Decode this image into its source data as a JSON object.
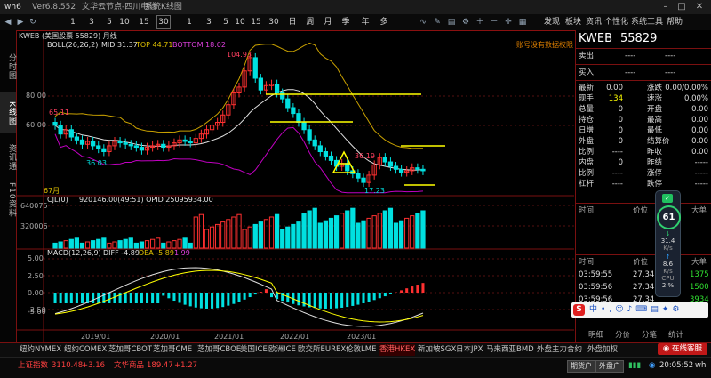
{
  "window": {
    "title": "wh6",
    "version": "Ver6.8.552",
    "node": "文华云节点-四川电信",
    "system": "系统K线图"
  },
  "toolbar": {
    "periods": [
      "1",
      "3",
      "5",
      "10",
      "15",
      "30",
      "1",
      "3",
      "5",
      "10",
      "15",
      "30",
      "日",
      "周",
      "月",
      "季",
      "年",
      "多"
    ],
    "menus": [
      "发现",
      "板块",
      "资讯",
      "个性化",
      "系统工具",
      "帮助"
    ]
  },
  "left_tabs": [
    "分时图",
    "K线图",
    "资讯通",
    "F10资料"
  ],
  "chart": {
    "symbol_header": "KWEB (美国股票 55829)  月线",
    "boll_label": "BOLL(26,26,2)",
    "mid_label": "MID 31.37",
    "top_label": "TOP 44.71",
    "bottom_label": "BOTTOM 18.02",
    "notice": "账号没有数据权限",
    "max_price": "104.93",
    "price_6511": "65.11",
    "price_3603": "36.03",
    "price_3619": "36.19",
    "price_1723": "17.23",
    "bar_count": "67月",
    "price_ticks": [
      "80.00",
      "60.00"
    ],
    "volume_label": "CJL(0)",
    "volume_values": "920146.00(49:51)  OPID 25095934.00",
    "volume_ticks": [
      "640075",
      "320006"
    ],
    "macd_label": "MACD(12,26,9)",
    "diff_label": "DIFF -4.89",
    "dea_label": "DEA -5.89",
    "macd_val": "1.99",
    "macd_ticks": [
      "5.00",
      "2.50",
      "0.00",
      "-2.50",
      "-5.00"
    ],
    "x_ticks": [
      "2019/01",
      "2020/01",
      "2021/01",
      "2022/01",
      "2023/01"
    ]
  },
  "right_panel": {
    "symbol": "KWEB",
    "code": "55829",
    "sell_label": "卖出",
    "buy_label": "买入",
    "dash": "----",
    "rows": [
      {
        "l1": "最新",
        "v1": "0.00",
        "l2": "涨跌",
        "v2": "0.00/0.00%"
      },
      {
        "l1": "现手",
        "v1": "134",
        "l2": "速涨",
        "v2": "0.00%"
      },
      {
        "l1": "总量",
        "v1": "0",
        "l2": "开盘",
        "v2": "0.00"
      },
      {
        "l1": "持仓",
        "v1": "0",
        "l2": "最高",
        "v2": "0.00"
      },
      {
        "l1": "日增",
        "v1": "0",
        "l2": "最低",
        "v2": "0.00"
      },
      {
        "l1": "外盘",
        "v1": "0",
        "l2": "结算价",
        "v2": "0.00"
      },
      {
        "l1": "比例",
        "v1": "----",
        "l2": "昨收",
        "v2": "0.00"
      },
      {
        "l1": "内盘",
        "v1": "0",
        "l2": "昨结",
        "v2": "-----"
      },
      {
        "l1": "比例",
        "v1": "----",
        "l2": "涨停",
        "v2": "-----"
      },
      {
        "l1": "杠杆",
        "v1": "----",
        "l2": "跌停",
        "v2": "-----"
      }
    ],
    "time_header": [
      "时间",
      "价位",
      "大单"
    ],
    "ticks": [
      {
        "t": "03:59:55",
        "p": "27.34",
        "v": "1375"
      },
      {
        "t": "03:59:56",
        "p": "27.34",
        "v": "1500"
      },
      {
        "t": "03:59:56",
        "p": "27.34",
        "v": "3934"
      }
    ],
    "bottom_tabs": [
      "明细",
      "分价",
      "分笔",
      "统计"
    ],
    "online_service": "在线客服"
  },
  "float_widget": {
    "score": "61",
    "speed1": "31.4",
    "unit1": "K/s",
    "speed2": "8.6",
    "unit2": "K/s",
    "cpu_label": "CPU",
    "cpu_value": "2",
    "cpu_unit": "%"
  },
  "bottom_tabs": [
    "纽约NYMEX",
    "纽约COMEX",
    "芝加哥CBOT",
    "芝加哥CME",
    "芝加哥CBOE",
    "美国ICE",
    "欧洲ICE",
    "欧交所EUREX",
    "伦敦LME",
    "香港HKEX",
    "新加坡SGX",
    "日本JPX",
    "马来西亚BMD",
    "外盘主力合约",
    "外盘加权"
  ],
  "status": {
    "index1_name": "上证指数",
    "index1_val": "3110.48",
    "index1_chg": "+3.16",
    "index2_name": "文华商品",
    "index2_val": "189.47",
    "index2_chg": "+1.27",
    "btn1": "期货户",
    "btn2": "外盘户",
    "time": "20:05:52",
    "user": "wh"
  },
  "colors": {
    "up": "#ff3030",
    "down": "#00e0e0",
    "boll_mid": "#e0e0e0",
    "boll_top": "#c8a000",
    "boll_bottom": "#c000c0",
    "yellow": "#ffff00"
  }
}
